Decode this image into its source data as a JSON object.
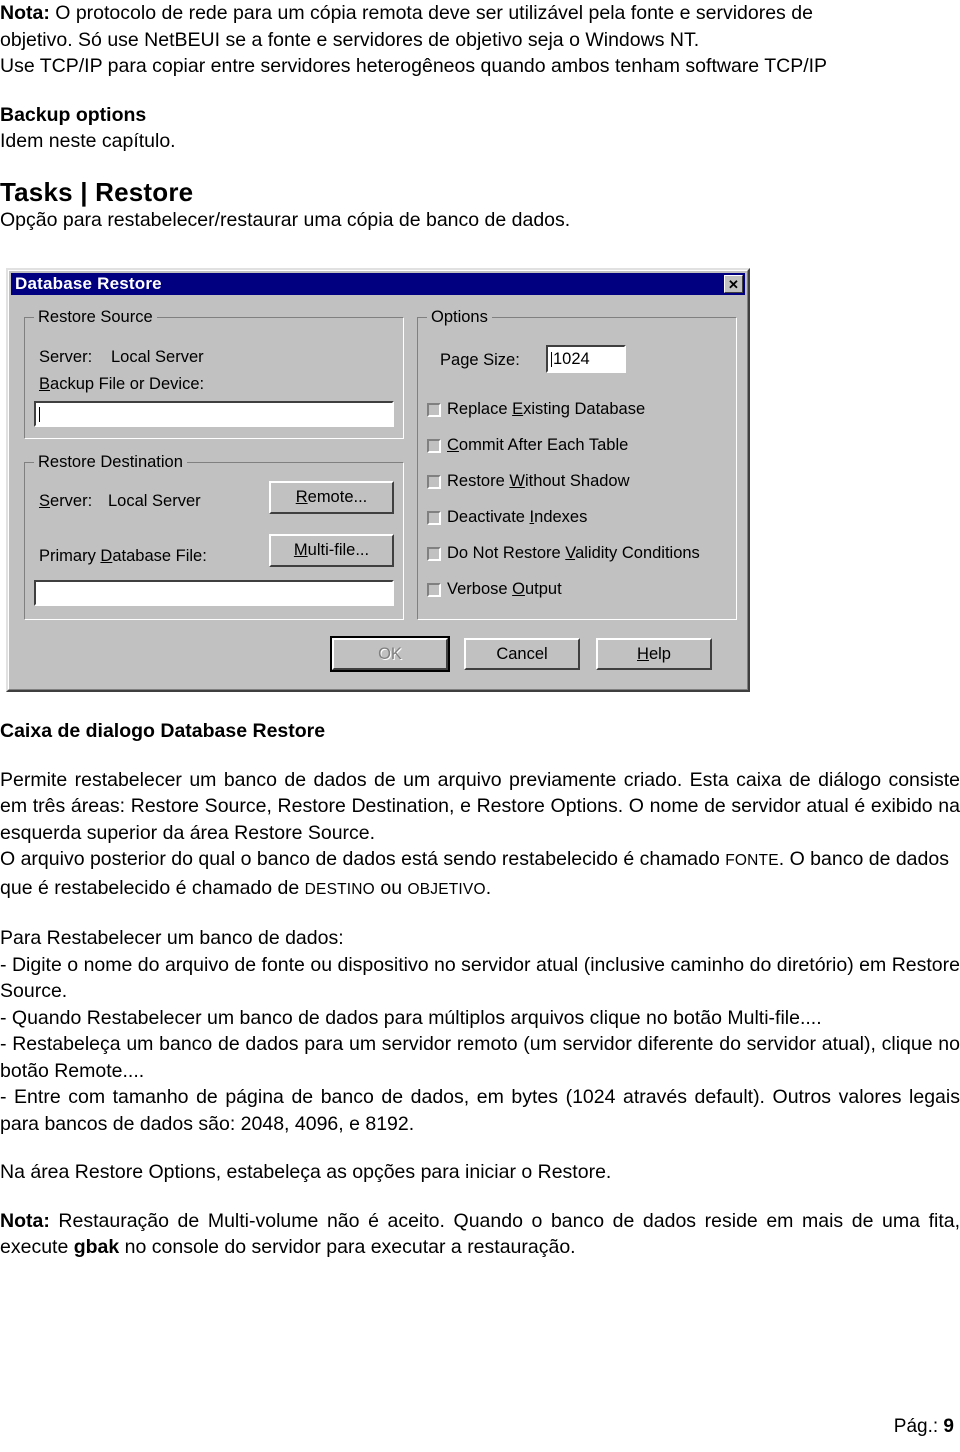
{
  "document": {
    "note1_label": "Nota:",
    "note1_line1": " O protocolo de rede para um cópia remota deve ser utilizável pela fonte e servidores de",
    "note1_line2": "objetivo.  Só use NetBEUI se a fonte e servidores de objetivo seja o Windows NT.",
    "note1_line3": "Use TCP/IP para copiar entre servidores heterogêneos quando ambos tenham software TCP/IP",
    "backup_options_heading": "Backup options",
    "backup_options_body": "Idem neste capítulo.",
    "tasks_restore_heading": "Tasks | Restore",
    "tasks_restore_body": "Opção para restabelecer/restaurar uma cópia de banco de dados.",
    "caption_heading": "Caixa de dialogo Database Restore",
    "desc_p1": "Permite restabelecer um banco de dados de um arquivo previamente criado. Esta caixa de diálogo consiste em três áreas: Restore Source, Restore Destination, e Restore Options. O nome de servidor atual é exibido na esquerda superior da área Restore Source.",
    "desc_p2_a": "O arquivo posterior do qual o banco de dados está sendo restabelecido é chamado ",
    "desc_p2_sc1": "FONTE",
    "desc_p2_b": ". O banco de dados que é restabelecido é chamado de ",
    "desc_p2_sc2": "DESTINO",
    "desc_p2_c": " ou ",
    "desc_p2_sc3": "OBJETIVO",
    "desc_p2_d": ".",
    "steps_heading": "Para Restabelecer um banco de dados:",
    "step1": "- Digite o nome do arquivo de fonte ou dispositivo no servidor atual (inclusive caminho do diretório)  em Restore Source.",
    "step2": "- Quando Restabelecer um banco de dados para múltiplos arquivos clique no botão Multi-file....",
    "step3": "- Restabeleça um banco de dados para um servidor remoto (um servidor diferente do servidor atual), clique no botão Remote....",
    "step4": "- Entre com tamanho de página de banco de dados, em bytes (1024 através default). Outros valores legais para bancos de dados são: 2048, 4096, e 8192.",
    "options_note": "Na área Restore Options, estabeleça as opções para iniciar o Restore.",
    "note2_label": "Nota:",
    "note2_a": "  Restauração de Multi-volume não é aceito.  Quando o banco de dados reside em mais de uma fita, execute ",
    "note2_bold": "gbak",
    "note2_b": " no console do servidor para executar a restauração."
  },
  "footer": {
    "page_label": "Pág.: ",
    "page_number": "9"
  },
  "dialog": {
    "title": "Database Restore",
    "close_icon": "✕",
    "restore_source": {
      "group_title": "Restore Source",
      "server_label": "Server:",
      "server_value": "Local Server",
      "backup_file_label_underlined": "B",
      "backup_file_label_rest": "ackup File or Device:",
      "backup_file_value": ""
    },
    "restore_destination": {
      "group_title": "Restore Destination",
      "server_label_underlined": "S",
      "server_label_rest": "erver:",
      "server_value": "Local Server",
      "remote_button_underlined": "R",
      "remote_button_rest": "emote...",
      "primary_db_label_pre": "Primary ",
      "primary_db_label_underlined": "D",
      "primary_db_label_rest": "atabase File:",
      "multifile_button_underlined": "M",
      "multifile_button_rest": "ulti-file...",
      "primary_db_value": ""
    },
    "options": {
      "group_title": "Options",
      "page_size_label_pre": "Pa",
      "page_size_label_underlined": "g",
      "page_size_label_rest": "e Size:",
      "page_size_value": "1024",
      "checkboxes": [
        {
          "pre": "Replace ",
          "key": "E",
          "post": "xisting Database",
          "checked": false
        },
        {
          "pre": "",
          "key": "C",
          "post": "ommit After Each Table",
          "checked": false
        },
        {
          "pre": "Restore ",
          "key": "W",
          "post": "ithout Shadow",
          "checked": false
        },
        {
          "pre": "Deactivate ",
          "key": "I",
          "post": "ndexes",
          "checked": false
        },
        {
          "pre": "Do Not Restore ",
          "key": "V",
          "post": "alidity Conditions",
          "checked": false
        },
        {
          "pre": "Verbose ",
          "key": "O",
          "post": "utput",
          "checked": false
        }
      ]
    },
    "buttons": {
      "ok": "OK",
      "ok_disabled": true,
      "cancel": "Cancel",
      "help_underlined": "H",
      "help_rest": "elp"
    }
  }
}
